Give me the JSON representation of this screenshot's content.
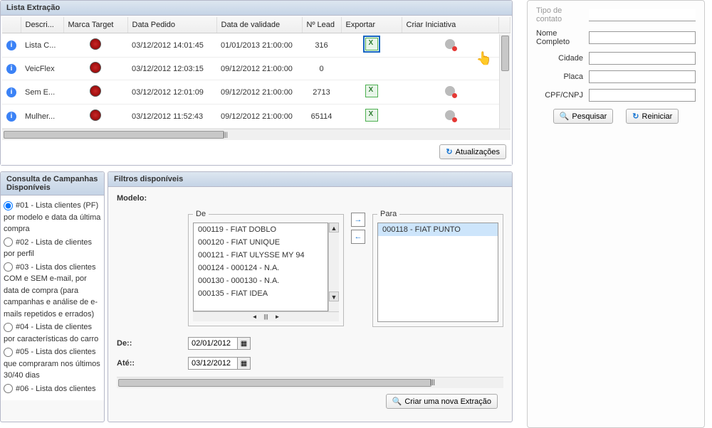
{
  "extract": {
    "title": "Lista Extração",
    "columns": [
      "",
      "Descri...",
      "Marca Target",
      "Data Pedido",
      "Data de validade",
      "Nº Lead",
      "Exportar",
      "Criar Iniciativa"
    ],
    "rows": [
      {
        "desc": "Lista C...",
        "data_pedido": "03/12/2012 14:01:45",
        "data_validade": "01/01/2013 21:00:00",
        "lead": "316",
        "export_boxed": true,
        "gear": true
      },
      {
        "desc": "VeicFlex",
        "data_pedido": "03/12/2012 12:03:15",
        "data_validade": "09/12/2012 21:00:00",
        "lead": "0",
        "export_boxed": false,
        "export_hidden": true,
        "gear": false
      },
      {
        "desc": "Sem E...",
        "data_pedido": "03/12/2012 12:01:09",
        "data_validade": "09/12/2012 21:00:00",
        "lead": "2713",
        "export_boxed": false,
        "gear": true
      },
      {
        "desc": "Mulher...",
        "data_pedido": "03/12/2012 11:52:43",
        "data_validade": "09/12/2012 21:00:00",
        "lead": "65114",
        "export_boxed": false,
        "gear": true
      }
    ],
    "update_btn": "Atualizações"
  },
  "campaigns": {
    "title": "Consulta de Campanhas Disponíveis",
    "items": [
      "#01 - Lista clientes (PF) por modelo e data da última compra",
      "#02 - Lista de clientes por perfil",
      "#03 - Lista dos clientes COM e SEM e-mail, por data de compra (para campanhas e análise de e-mails repetidos e errados)",
      "#04 - Lista de clientes por características do carro",
      "#05 - Lista dos clientes que compraram nos últimos 30/40 dias",
      "#06 - Lista dos clientes"
    ],
    "selected": 0
  },
  "filters": {
    "title": "Filtros disponíveis",
    "model_label": "Modelo:",
    "from_legend": "De",
    "to_legend": "Para",
    "from_options": [
      "000119 - FIAT DOBLO",
      "000120 - FIAT UNIQUE",
      "000121 - FIAT ULYSSE MY 94",
      "000124 - 000124 - N.A.",
      "000130 - 000130 - N.A.",
      "000135 - FIAT IDEA"
    ],
    "to_options": [
      "000118 - FIAT PUNTO"
    ],
    "from_label": "De::",
    "to_label": "Até::",
    "from_value": "02/01/2012",
    "to_value": "03/12/2012",
    "create_btn": "Criar uma nova Extração"
  },
  "search": {
    "tipo_label": "Tipo de contato",
    "nome_label": "Nome Completo",
    "cidade_label": "Cidade",
    "placa_label": "Placa",
    "cpf_label": "CPF/CNPJ",
    "pesquisar": "Pesquisar",
    "reiniciar": "Reiniciar"
  }
}
